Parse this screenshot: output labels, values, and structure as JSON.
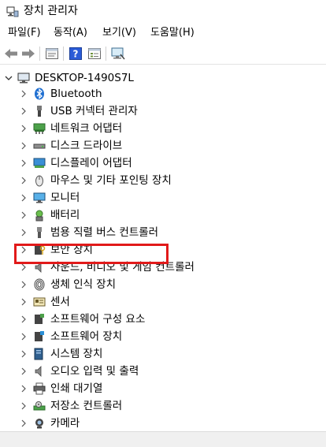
{
  "window": {
    "title": "장치 관리자"
  },
  "menu": [
    {
      "label": "파일(F)"
    },
    {
      "label": "동작(A)"
    },
    {
      "label": "보기(V)"
    },
    {
      "label": "도움말(H)"
    }
  ],
  "tree": {
    "root": {
      "label": "DESKTOP-1490S7L"
    },
    "items": [
      {
        "label": "Bluetooth",
        "icon": "bluetooth-icon"
      },
      {
        "label": "USB 커넥터 관리자",
        "icon": "usb-connector-icon"
      },
      {
        "label": "네트워크 어댑터",
        "icon": "network-adapter-icon"
      },
      {
        "label": "디스크 드라이브",
        "icon": "disk-drive-icon"
      },
      {
        "label": "디스플레이 어댑터",
        "icon": "display-adapter-icon"
      },
      {
        "label": "마우스 및 기타 포인팅 장치",
        "icon": "mouse-icon"
      },
      {
        "label": "모니터",
        "icon": "monitor-icon"
      },
      {
        "label": "배터리",
        "icon": "battery-icon"
      },
      {
        "label": "범용 직렬 버스 컨트롤러",
        "icon": "usb-controller-icon"
      },
      {
        "label": "보안 장치",
        "icon": "security-device-icon"
      },
      {
        "label": "사운드, 비디오 및 게임 컨트롤러",
        "icon": "speaker-icon"
      },
      {
        "label": "생체 인식 장치",
        "icon": "fingerprint-icon"
      },
      {
        "label": "센서",
        "icon": "sensor-icon"
      },
      {
        "label": "소프트웨어 구성 요소",
        "icon": "software-component-icon"
      },
      {
        "label": "소프트웨어 장치",
        "icon": "software-device-icon"
      },
      {
        "label": "시스템 장치",
        "icon": "system-device-icon"
      },
      {
        "label": "오디오 입력 및 출력",
        "icon": "audio-io-icon"
      },
      {
        "label": "인쇄 대기열",
        "icon": "printer-icon"
      },
      {
        "label": "저장소 컨트롤러",
        "icon": "storage-controller-icon"
      },
      {
        "label": "카메라",
        "icon": "camera-icon"
      }
    ]
  },
  "colors": {
    "highlight": "#e11a1a"
  }
}
